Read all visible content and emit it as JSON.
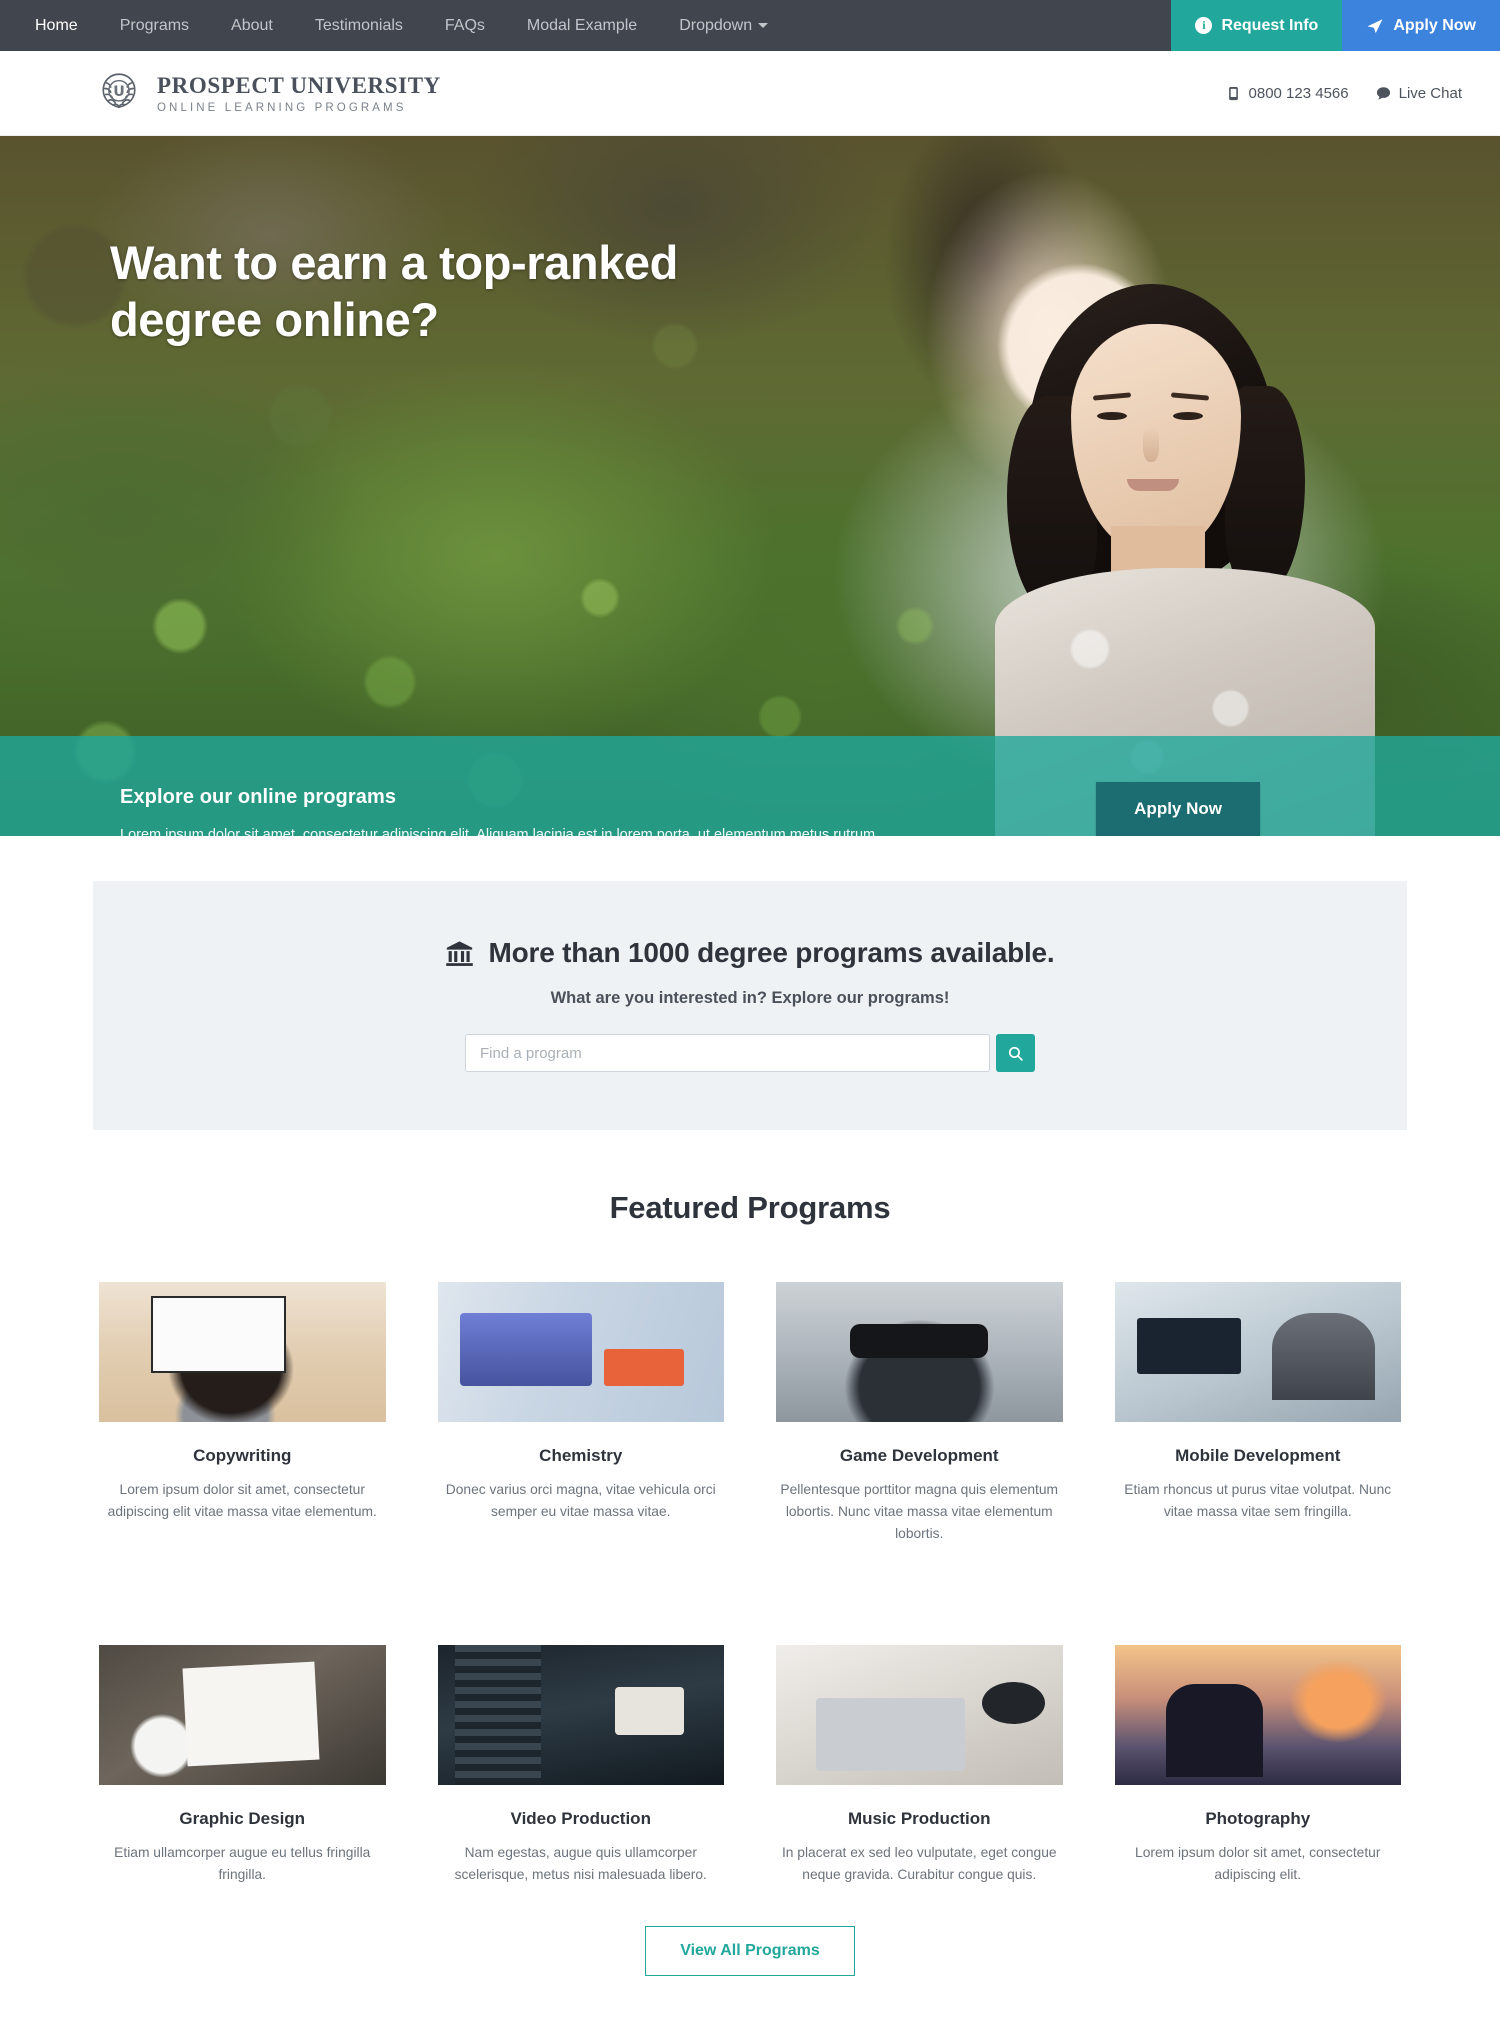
{
  "topnav": {
    "links": [
      {
        "label": "Home",
        "active": true
      },
      {
        "label": "Programs",
        "active": false
      },
      {
        "label": "About",
        "active": false
      },
      {
        "label": "Testimonials",
        "active": false
      },
      {
        "label": "FAQs",
        "active": false
      },
      {
        "label": "Modal Example",
        "active": false
      },
      {
        "label": "Dropdown",
        "active": false,
        "caret": true
      }
    ],
    "request_info_label": "Request Info",
    "apply_now_label": "Apply Now",
    "colors": {
      "bar": "#41454d",
      "request_info": "#21a79b",
      "apply_now": "#3b83dd"
    }
  },
  "header": {
    "brand_name": "PROSPECT UNIVERSITY",
    "brand_sub": "ONLINE LEARNING PROGRAMS",
    "phone": "0800 123 4566",
    "live_chat": "Live Chat"
  },
  "hero": {
    "title": "Want to earn a top-ranked degree online?",
    "band_title": "Explore our online programs",
    "band_text": "Lorem ipsum dolor sit amet, consectetur adipiscing elit. Aliquam lacinia est in lorem porta, ut elementum metus rutrum. Vivamus pharetra fringilla hendrerit.",
    "apply_label": "Apply Now",
    "carousel": {
      "total": 3,
      "active_index": 0
    },
    "band_color": "#21a79b",
    "apply_button_color": "#1b6d71"
  },
  "search": {
    "heading": "More than 1000 degree programs available.",
    "subheading": "What are you interested in? Explore our programs!",
    "placeholder": "Find a program",
    "value": "",
    "button_color": "#21a79b",
    "panel_color": "#eef2f5"
  },
  "featured": {
    "heading": "Featured Programs",
    "view_all_label": "View All Programs",
    "cards": [
      {
        "title": "Copywriting",
        "desc": "Lorem ipsum dolor sit amet, consectetur adipiscing elit vitae massa vitae elementum.",
        "art": "a-copy"
      },
      {
        "title": "Chemistry",
        "desc": "Donec varius orci magna, vitae vehicula orci semper eu vitae massa vitae.",
        "art": "a-chem"
      },
      {
        "title": "Game Development",
        "desc": "Pellentesque porttitor magna quis elementum lobortis. Nunc vitae massa vitae elementum lobortis.",
        "art": "a-game"
      },
      {
        "title": "Mobile Development",
        "desc": "Etiam rhoncus ut purus vitae volutpat. Nunc vitae massa vitae sem fringilla.",
        "art": "a-mobile"
      },
      {
        "title": "Graphic Design",
        "desc": "Etiam ullamcorper augue eu tellus fringilla fringilla.",
        "art": "a-graphic"
      },
      {
        "title": "Video Production",
        "desc": "Nam egestas, augue quis ullamcorper scelerisque, metus nisi malesuada libero.",
        "art": "a-video"
      },
      {
        "title": "Music Production",
        "desc": "In placerat ex sed leo vulputate, eget congue neque gravida. Curabitur congue quis.",
        "art": "a-music"
      },
      {
        "title": "Photography",
        "desc": "Lorem ipsum dolor sit amet, consectetur adipiscing elit.",
        "art": "a-photo"
      }
    ]
  },
  "icons": {
    "info": "info-circle-icon",
    "plane": "paper-plane-icon",
    "phone": "phone-icon",
    "chat": "chat-bubble-icon",
    "bank": "bank-building-icon",
    "search": "search-icon",
    "crest": "university-crest-icon",
    "caret": "chevron-down-icon"
  }
}
